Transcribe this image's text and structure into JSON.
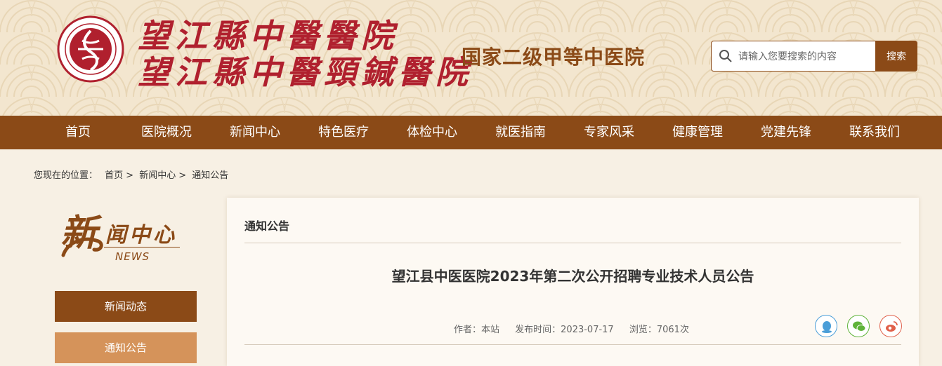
{
  "header": {
    "seal_text": "望江縣中醫醫院",
    "seal_mark": "中",
    "name_line1": "望江縣中醫醫院",
    "name_line2": "望江縣中醫頸鍼醫院",
    "slogan": "国家二级甲等中医院",
    "search": {
      "placeholder": "请输入您要搜索的内容",
      "button_label": "搜索"
    }
  },
  "nav": {
    "items": [
      "首页",
      "医院概况",
      "新闻中心",
      "特色医疗",
      "体检中心",
      "就医指南",
      "专家风采",
      "健康管理",
      "党建先锋",
      "联系我们"
    ]
  },
  "breadcrumb": {
    "prefix": "您现在的位置：",
    "items": [
      "首页",
      "新闻中心",
      "通知公告"
    ],
    "separator": ">"
  },
  "sidebar": {
    "title_first_char": "新",
    "title_rest": "闻中心",
    "title_en": "NEWS",
    "items": [
      "新闻动态",
      "通知公告"
    ]
  },
  "content": {
    "section_title": "通知公告",
    "article_title": "望江县中医医院2023年第二次公开招聘专业技术人员公告",
    "meta": {
      "author": "作者：本站",
      "date": "发布时间：2023-07-17",
      "views": "浏览：7061次"
    }
  },
  "colors": {
    "brand_brown": "#8b4a17",
    "seal_red": "#b0202e",
    "header_bg": "#f3e6cf",
    "sidebar_inactive": "#d5935a"
  }
}
